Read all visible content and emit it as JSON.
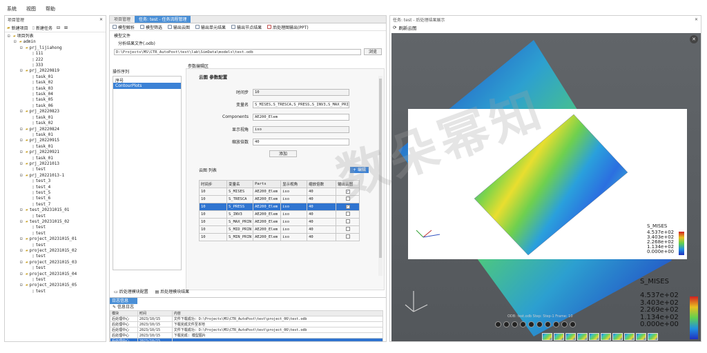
{
  "menu": [
    "系统",
    "视图",
    "帮助"
  ],
  "left_panel": {
    "title": "项目管理",
    "toolbar": [
      "新建项目",
      "新建任务"
    ],
    "tree": [
      {
        "label": "项目列表",
        "level": 0,
        "kind": "root"
      },
      {
        "label": "admin",
        "level": 1,
        "kind": "user"
      },
      {
        "label": "prj_lijiahong",
        "level": 2,
        "kind": "folder"
      },
      {
        "label": "111",
        "level": 3,
        "kind": "doc"
      },
      {
        "label": "222",
        "level": 3,
        "kind": "doc"
      },
      {
        "label": "333",
        "level": 3,
        "kind": "doc"
      },
      {
        "label": "prj_20220819",
        "level": 2,
        "kind": "folder"
      },
      {
        "label": "task_01",
        "level": 3,
        "kind": "doc"
      },
      {
        "label": "task_02",
        "level": 3,
        "kind": "doc"
      },
      {
        "label": "task_03",
        "level": 3,
        "kind": "doc"
      },
      {
        "label": "task_04",
        "level": 3,
        "kind": "doc"
      },
      {
        "label": "task_05",
        "level": 3,
        "kind": "doc"
      },
      {
        "label": "task_06",
        "level": 3,
        "kind": "doc"
      },
      {
        "label": "prj_20220823",
        "level": 2,
        "kind": "folder"
      },
      {
        "label": "task_01",
        "level": 3,
        "kind": "doc"
      },
      {
        "label": "task_02",
        "level": 3,
        "kind": "doc"
      },
      {
        "label": "prj_20220824",
        "level": 2,
        "kind": "folder"
      },
      {
        "label": "task_01",
        "level": 3,
        "kind": "doc"
      },
      {
        "label": "prj_20220915",
        "level": 2,
        "kind": "folder"
      },
      {
        "label": "task_01",
        "level": 3,
        "kind": "doc"
      },
      {
        "label": "prj_20220921",
        "level": 2,
        "kind": "folder"
      },
      {
        "label": "task_01",
        "level": 3,
        "kind": "doc"
      },
      {
        "label": "prj_20221013",
        "level": 2,
        "kind": "folder"
      },
      {
        "label": "test",
        "level": 3,
        "kind": "doc"
      },
      {
        "label": "prj_20221013-1",
        "level": 2,
        "kind": "folder"
      },
      {
        "label": "test_3",
        "level": 3,
        "kind": "doc"
      },
      {
        "label": "test_4",
        "level": 3,
        "kind": "doc"
      },
      {
        "label": "test_5",
        "level": 3,
        "kind": "doc"
      },
      {
        "label": "test_6",
        "level": 3,
        "kind": "doc"
      },
      {
        "label": "test_7",
        "level": 3,
        "kind": "doc"
      },
      {
        "label": "test_20231015_01",
        "level": 2,
        "kind": "folder"
      },
      {
        "label": "test",
        "level": 3,
        "kind": "doc"
      },
      {
        "label": "test_20231015_02",
        "level": 2,
        "kind": "folder"
      },
      {
        "label": "test",
        "level": 3,
        "kind": "doc"
      },
      {
        "label": "test",
        "level": 3,
        "kind": "doc"
      },
      {
        "label": "project_20231015_01",
        "level": 2,
        "kind": "folder"
      },
      {
        "label": "test",
        "level": 3,
        "kind": "doc"
      },
      {
        "label": "project_20231015_02",
        "level": 2,
        "kind": "folder"
      },
      {
        "label": "test",
        "level": 3,
        "kind": "doc"
      },
      {
        "label": "project_20231015_03",
        "level": 2,
        "kind": "folder"
      },
      {
        "label": "test",
        "level": 3,
        "kind": "doc"
      },
      {
        "label": "project_20231015_04",
        "level": 2,
        "kind": "folder"
      },
      {
        "label": "test",
        "level": 3,
        "kind": "doc"
      },
      {
        "label": "project_20231015_05",
        "level": 2,
        "kind": "folder"
      },
      {
        "label": "test",
        "level": 3,
        "kind": "doc"
      }
    ]
  },
  "center": {
    "tabs": [
      "项目管理",
      "任务: test - 任务流程管理"
    ],
    "toolbar": [
      "模型解析",
      "模型筛选",
      "输出云图",
      "输出单元结果",
      "输出节点结果",
      "后处理图输出(PPT)"
    ],
    "file_section_label": "模型文件",
    "file_field_label": "分析结果文件(.odb)",
    "file_path": "D:\\Projects\\MS\\CTR_AutoPost\\test\\lab\\SimData\\models\\test.odb",
    "browse_label": "浏览",
    "seq_label": "操作序列",
    "seq_header": "序号",
    "seq_items": [
      "ContourPlots"
    ],
    "param_label": "参数编辑区",
    "param_section": "云图 参数配置",
    "fields": [
      {
        "label": "时间步",
        "value": "10"
      },
      {
        "label": "变量名",
        "value": "S_MISES,S_TRESCA,S_PRESS,S_INV3,S_MAX_PRIN"
      },
      {
        "label": "Components",
        "value": "AE200_Elem"
      },
      {
        "label": "显示视角",
        "value": "iso"
      },
      {
        "label": "缩放倍数",
        "value": "40"
      }
    ],
    "add_label": "添加",
    "table_label": "云图 列表",
    "edit_label": "编辑",
    "table_headers": [
      "时间步",
      "变量名",
      "Parts",
      "显示视角",
      "缩放倍数",
      "输出云图"
    ],
    "table_rows": [
      {
        "cells": [
          "10",
          "S_MISES",
          "AE200_Elem",
          "iso",
          "40"
        ],
        "checked": true,
        "selected": false
      },
      {
        "cells": [
          "10",
          "S_TRESCA",
          "AE200_Elem",
          "iso",
          "40"
        ],
        "checked": false,
        "selected": false
      },
      {
        "cells": [
          "10",
          "S_PRESS",
          "AE200_Elem",
          "iso",
          "40"
        ],
        "checked": true,
        "selected": true
      },
      {
        "cells": [
          "10",
          "S_INV3",
          "AE200_Elem",
          "iso",
          "40"
        ],
        "checked": false,
        "selected": false
      },
      {
        "cells": [
          "10",
          "S_MAX_PRIN",
          "AE200_Elem",
          "iso",
          "40"
        ],
        "checked": false,
        "selected": false
      },
      {
        "cells": [
          "10",
          "S_MID_PRIN",
          "AE200_Elem",
          "iso",
          "40"
        ],
        "checked": false,
        "selected": false
      },
      {
        "cells": [
          "10",
          "S_MIN_PRIN",
          "AE200_Elem",
          "iso",
          "40"
        ],
        "checked": false,
        "selected": false
      }
    ],
    "bottom_tabs": [
      "后处理模块配置",
      "后处理模块结果"
    ],
    "log_tab": "日志信息",
    "log_title": "信息日志",
    "log_headers": [
      "模块",
      "时间",
      "内容"
    ],
    "log_rows": [
      {
        "cells": [
          "后处理中心",
          "2023/10/15",
          "文件下载成功: D:\\Projects\\MS\\CTR_AutoPost\\test\\project_06\\test.odb"
        ],
        "selected": false
      },
      {
        "cells": [
          "后处理中心",
          "2023/10/15",
          "下载完成文件至本地"
        ],
        "selected": false
      },
      {
        "cells": [
          "后处理中心",
          "2023/10/15",
          "文件下载成功: D:\\Projects\\MS\\CTR_AutoPost\\test\\project_06\\test.odb"
        ],
        "selected": false
      },
      {
        "cells": [
          "后处理中心",
          "2023/10/15",
          "下载完成: 模型图片"
        ],
        "selected": false
      },
      {
        "cells": [
          "后处理中心",
          "2023/10/15",
          ""
        ],
        "selected": true
      }
    ]
  },
  "right": {
    "title": "任务: test - 后处理结果展示",
    "refresh_label": "刷新云图",
    "legend_small_title": "S_MISES",
    "legend_small": [
      "4.537e+02",
      "3.403e+02",
      "2.268e+02",
      "1.134e+02",
      "0.000e+00"
    ],
    "legend_big_title": "S_MISES",
    "legend_big": [
      "4.537e+02",
      "3.403e+02",
      "2.269e+02",
      "1.134e+02",
      "0.000e+00"
    ],
    "frame_caption": "ODB: test.odb  Step: Step-1  Frame: 10"
  },
  "watermark": "数朵幂知"
}
